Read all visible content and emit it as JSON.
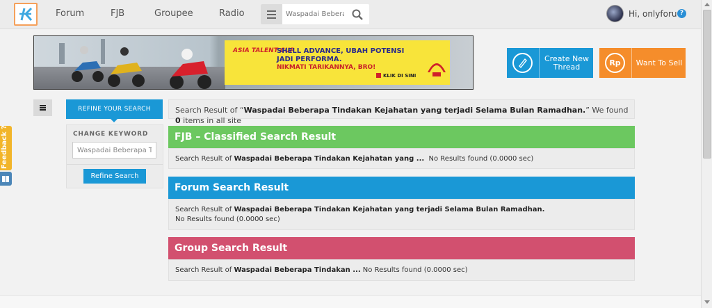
{
  "nav": {
    "items": [
      "Forum",
      "FJB",
      "Groupee",
      "Radio"
    ],
    "search_value": "Waspadai Beberapa Tindakan Kejahatan yang terjadi Selama Bulan Ramadhan.",
    "user_greeting": "Hi, onlyforu",
    "help_label": "?"
  },
  "banner": {
    "brand": "ASIA TALENT CUP",
    "headline": "SHELL ADVANCE, UBAH POTENSI JADI PERFORMA.",
    "sub": "NIKMATI TARIKANNYA, BRO!",
    "cta": "KLIK DI SINI"
  },
  "actions": {
    "create_label": "Create New Thread",
    "sell_label": "Want To Sell",
    "sell_icon": "Rp"
  },
  "filter": {
    "tab_label": "REFINE YOUR SEARCH",
    "change_keyword_label": "CHANGE KEYWORD",
    "keyword_value": "Waspadai Beberapa Tindakan Kejahatan yang terjadi Selama Bulan Ramadhan.",
    "refine_button": "Refine Search"
  },
  "feedback_label": "Feedback ?",
  "summary": {
    "prefix": "Search Result of “",
    "query": "Waspadai Beberapa Tindakan Kejahatan yang terjadi Selama Bulan Ramadhan.",
    "mid": "” We found ",
    "count": "0",
    "suffix": " items in all site"
  },
  "sections": {
    "fjb": {
      "title": "FJB – Classified Search Result",
      "prefix": "Search Result of ",
      "query": "Waspadai Beberapa Tindakan Kejahatan yang ...",
      "status": "  No Results found (0.0000 sec)",
      "color": "#6cc860"
    },
    "forum": {
      "title": "Forum Search Result",
      "prefix": "Search Result of ",
      "query": "Waspadai Beberapa Tindakan Kejahatan yang terjadi Selama Bulan Ramadhan.",
      "status": " No Results found (0.0000 sec)",
      "color": "#1a98d6"
    },
    "group": {
      "title": "Group Search Result",
      "prefix": "Search Result of ",
      "query": "Waspadai Beberapa Tindakan ...",
      "status": " No Results found (0.0000 sec)",
      "color": "#d2506f"
    }
  }
}
